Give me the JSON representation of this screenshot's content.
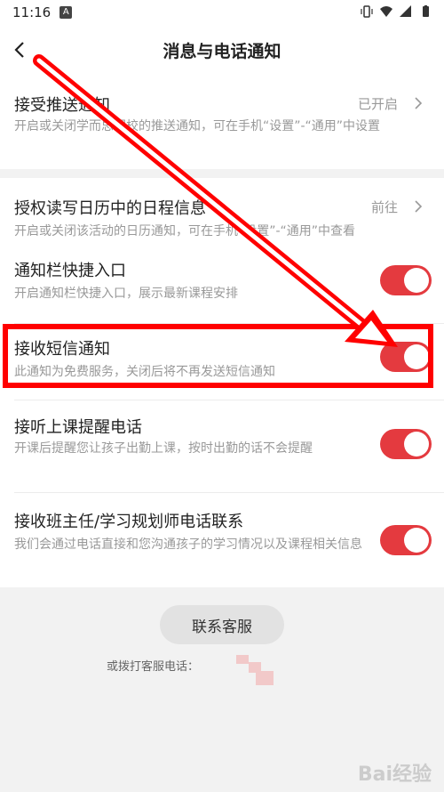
{
  "status_bar": {
    "time": "11:16",
    "app_badge": "A"
  },
  "header": {
    "title": "消息与电话通知"
  },
  "settings": {
    "push": {
      "label": "接受推送通知",
      "status": "已开启",
      "desc": "开启或关闭学而思网校的推送通知，可在手机“设置”-“通用”中设置"
    },
    "calendar": {
      "label": "授权读写日历中的日程信息",
      "status": "前往",
      "desc": "开启或关闭该活动的日历通知，可在手机“设置”-“通用”中查看"
    },
    "shortcut": {
      "label": "通知栏快捷入口",
      "desc": "开启通知栏快捷入口，展示最新课程安排",
      "enabled": true
    },
    "sms": {
      "label": "接收短信通知",
      "desc": "此通知为免费服务，关闭后将不再发送短信通知",
      "enabled": true
    },
    "class_call": {
      "label": "接听上课提醒电话",
      "desc": "开课后提醒您让孩子出勤上课，按时出勤的话不会提醒",
      "enabled": true
    },
    "teacher_call": {
      "label": "接收班主任/学习规划师电话联系",
      "desc": "我们会通过电话直接和您沟通孩子的学习情况以及课程相关信息",
      "enabled": true
    }
  },
  "footer": {
    "contact_button": "联系客服",
    "hotline_label": "或拨打客服电话："
  },
  "watermark": "Bai经验",
  "colors": {
    "toggle_on": "#e43a3f",
    "highlight": "#ff0000",
    "annotation_arrow": "#ff0000"
  }
}
